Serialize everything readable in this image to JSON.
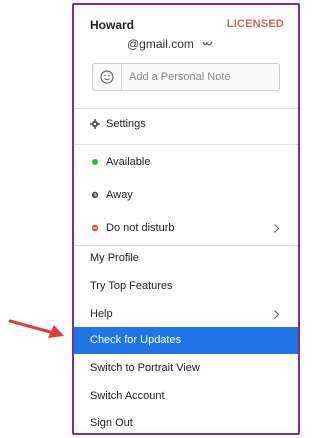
{
  "account": {
    "name": "Howard",
    "license": "LICENSED",
    "email": "@gmail.com",
    "note_placeholder": "Add a Personal Note"
  },
  "menu": {
    "settings": "Settings",
    "available": "Available",
    "away": "Away",
    "do_not_disturb": "Do not disturb",
    "my_profile": "My Profile",
    "try_top_features": "Try Top Features",
    "help": "Help",
    "check_for_updates": "Check for Updates",
    "switch_portrait": "Switch to Portrait View",
    "switch_account": "Switch Account",
    "sign_out": "Sign Out"
  },
  "colors": {
    "border": "#7a2d9c",
    "license": "#c9655f",
    "selected": "#1f74e6",
    "available": "#2db84d",
    "dnd": "#e0483f",
    "arrow": "#e23b3b"
  }
}
